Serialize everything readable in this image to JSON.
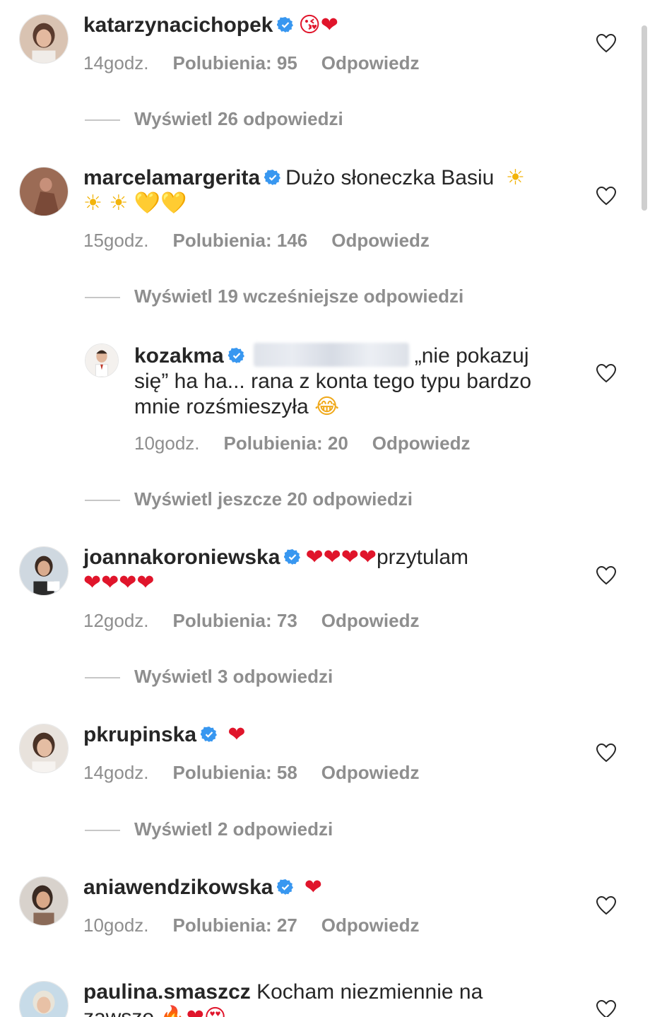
{
  "comments": [
    {
      "username": "katarzynacichopek",
      "emoji_tail": "😘❤",
      "time": "14godz.",
      "likes": "Polubienia: 95",
      "reply": "Odpowiedz",
      "view_replies": "Wyświetl 26 odpowiedzi"
    },
    {
      "username": "marcelamargerita",
      "text": "Dużo słoneczka Basiu",
      "emoji_line1": "☀",
      "emoji_line2_suns": "☀ ☀",
      "emoji_line2_hearts": "💛💛",
      "time": "15godz.",
      "likes": "Polubienia: 146",
      "reply": "Odpowiedz",
      "view_replies": "Wyświetl 19 wcześniejsze odpowiedzi"
    },
    {
      "username": "kozakma",
      "text_line1": "„nie pokazuj",
      "text_line2": "się” ha ha... rana z konta tego typu bardzo",
      "text_line3": "mnie rozśmieszyła",
      "emoji_tail": "😂",
      "time": "10godz.",
      "likes": "Polubienia: 20",
      "reply": "Odpowiedz",
      "view_replies": "Wyświetl jeszcze 20 odpowiedzi"
    },
    {
      "username": "joannakoroniewska",
      "emoji_line1": "❤❤❤❤",
      "text": "przytulam",
      "emoji_line2": "❤❤❤❤",
      "time": "12godz.",
      "likes": "Polubienia: 73",
      "reply": "Odpowiedz",
      "view_replies": "Wyświetl 3 odpowiedzi"
    },
    {
      "username": "pkrupinska",
      "emoji_tail": "❤",
      "time": "14godz.",
      "likes": "Polubienia: 58",
      "reply": "Odpowiedz",
      "view_replies": "Wyświetl 2 odpowiedzi"
    },
    {
      "username": "aniawendzikowska",
      "emoji_tail": "❤",
      "time": "10godz.",
      "likes": "Polubienia: 27",
      "reply": "Odpowiedz"
    },
    {
      "username": "paulina.smaszcz",
      "text": "Kocham niezmiennie na",
      "text_line2": "zawsze",
      "emoji_tail": "🔥❤😍"
    }
  ],
  "colors": {
    "verified": "#3897f0",
    "heart": "#e0152b",
    "meta": "#8e8e8e",
    "text": "#262626"
  }
}
